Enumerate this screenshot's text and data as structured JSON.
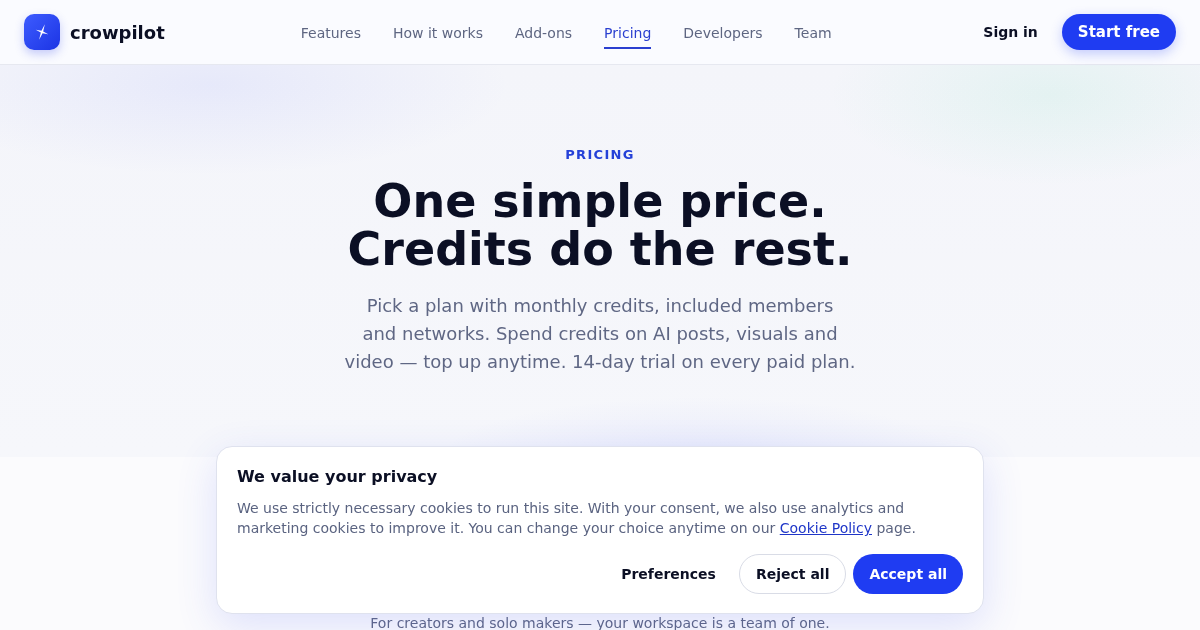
{
  "header": {
    "brand": "crowpilot",
    "nav": [
      {
        "label": "Features",
        "selected": false
      },
      {
        "label": "How it works",
        "selected": false
      },
      {
        "label": "Add-ons",
        "selected": false
      },
      {
        "label": "Pricing",
        "selected": true
      },
      {
        "label": "Developers",
        "selected": false
      },
      {
        "label": "Team",
        "selected": false
      }
    ],
    "sign_in": "Sign in",
    "start_button": "Start free"
  },
  "hero": {
    "eyebrow": "PRICING",
    "title_lines": [
      "One simple price.",
      "Credits do the rest."
    ],
    "subtitle": "Pick a plan with monthly credits, included members and networks. Spend credits on AI posts, visuals and video — top up anytime. 14-day trial on every paid plan."
  },
  "plan_intro": "For creators and solo makers — your workspace is a team of one.",
  "cookie_banner": {
    "title": "We value your privacy",
    "text_before": "We use strictly necessary cookies to run this site. With your consent, we also use analytics and marketing cookies to improve it. You can change your choice anytime on our",
    "link": "Cookie Policy",
    "text_after": "page.",
    "buttons": [
      {
        "label": "Preferences",
        "kind": "text"
      },
      {
        "label": "Reject all",
        "kind": "outline"
      },
      {
        "label": "Accept all",
        "kind": "primary"
      }
    ]
  }
}
